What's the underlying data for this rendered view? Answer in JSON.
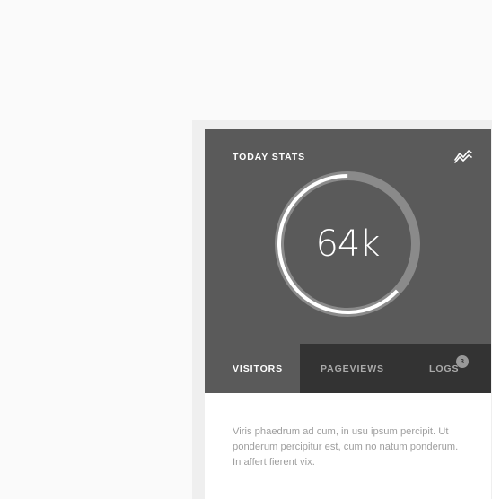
{
  "widget": {
    "title": "TODAY STATS",
    "icon": "trend-chart-icon",
    "value": "64k",
    "progress_percent": 63,
    "colors": {
      "header": "#5a5a5a",
      "tab_dark": "#333333",
      "progress": "#ffffff",
      "track": "#8a8a8a"
    }
  },
  "tabs": {
    "visitors": "VISITORS",
    "pageviews": "PAGEVIEWS",
    "logs": "LOGS",
    "logs_badge": "3"
  },
  "body": {
    "text": "Viris phaedrum ad cum, in usu ipsum percipit. Ut ponderum percipitur est, cum no natum ponderum. In affert fierent vix."
  }
}
